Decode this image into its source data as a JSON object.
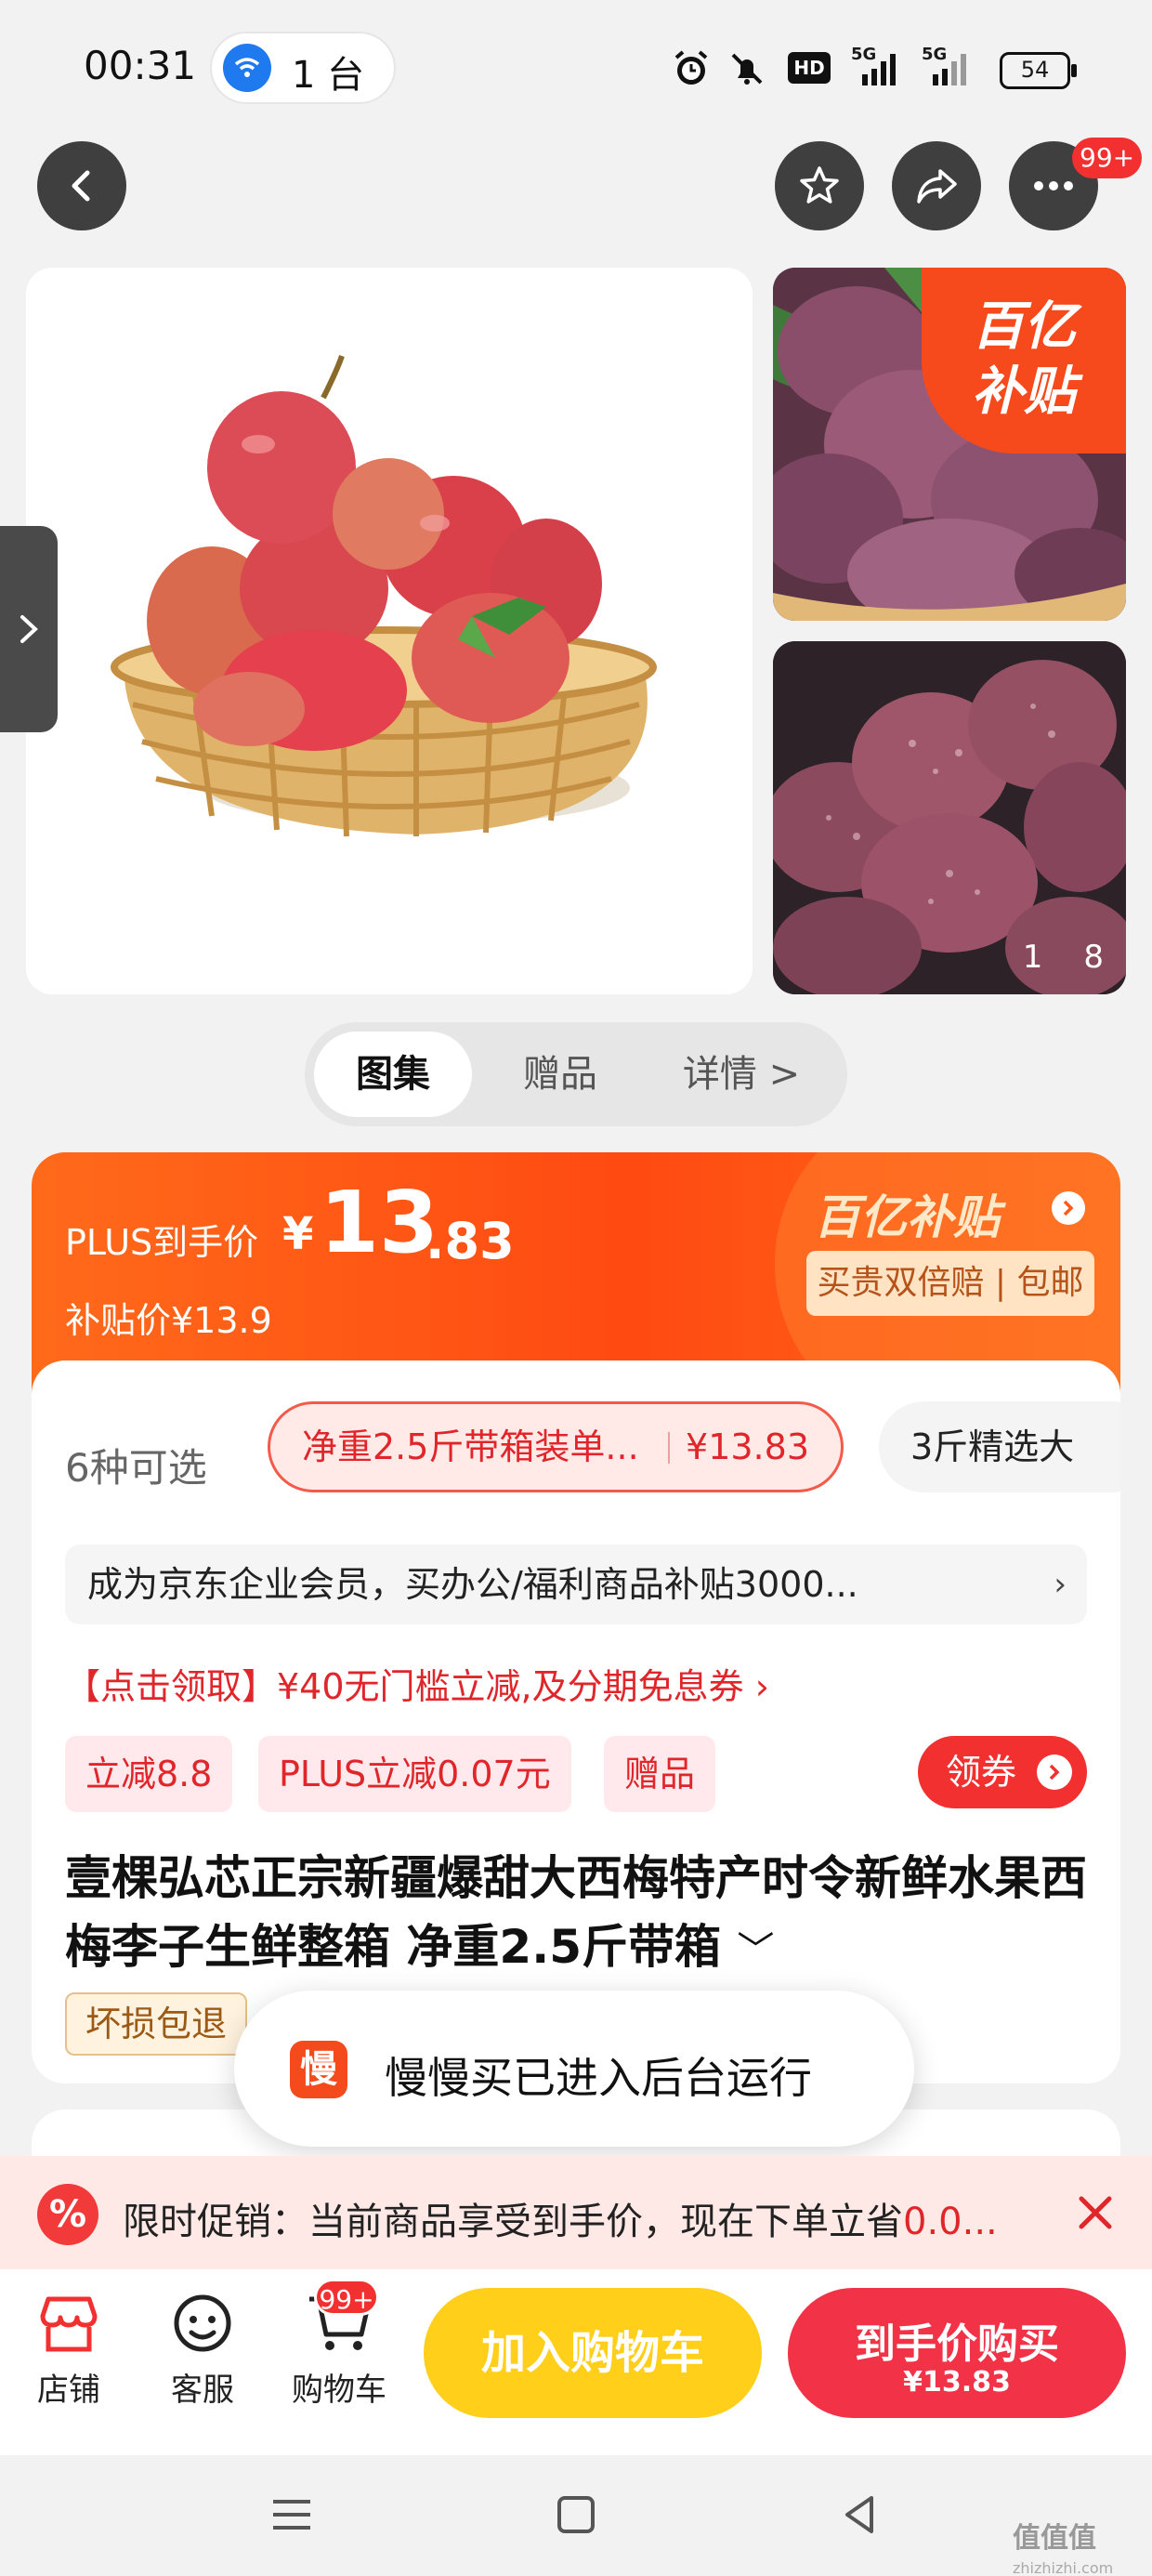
{
  "status_bar": {
    "time": "00:31",
    "hotspot_count": "1 台",
    "network_labels": [
      "HD",
      "5G",
      "5G"
    ],
    "battery": "54"
  },
  "nav": {
    "more_badge": "99+"
  },
  "gallery": {
    "pager_current": "1",
    "pager_total": "8",
    "promo_corner_line1": "百亿",
    "promo_corner_line2": "补贴"
  },
  "tabs": [
    {
      "label": "图集",
      "active": true
    },
    {
      "label": "赠品",
      "active": false
    },
    {
      "label": "详情 >",
      "active": false
    }
  ],
  "price": {
    "plus_label": "PLUS到手价",
    "currency": "¥",
    "integer": "13",
    "decimal": ".83",
    "subsidy_price": "补贴价¥13.9",
    "brand": "百亿补贴",
    "guarantee": "买贵双倍赔 | 包邮"
  },
  "options": {
    "count_label": "6种可选",
    "selected_name": "净重2.5斤带箱装单...",
    "selected_price": "¥13.83",
    "other_name": "3斤精选大"
  },
  "member_row": "成为京东企业会员，买办公/福利商品补贴3000...",
  "coupon_line": "【点击领取】¥40无门槛立减,及分期免息券 ›",
  "tags": [
    "立减8.8",
    "PLUS立减0.07元",
    "赠品"
  ],
  "coupon_button": "领券",
  "product_title": "壹棵弘芯正宗新疆爆甜大西梅特产时令新鲜水果西梅李子生鲜整箱 净重2.5斤带箱",
  "damage_tag": "坏损包退",
  "toast": {
    "icon_text": "慢",
    "message": "慢慢买已进入后台运行"
  },
  "promo_bar": {
    "prefix": "限时促销：当前商品享受到手价，现在下单立省",
    "amount": "0.0..."
  },
  "action_bar": {
    "shop": "店铺",
    "service": "客服",
    "cart": "购物车",
    "cart_badge": "99+",
    "add_to_cart": "加入购物车",
    "buy_line1": "到手价购买",
    "buy_line2": "¥13.83"
  },
  "watermark": {
    "main": "值值值",
    "sub": "zhizhizhi.com"
  },
  "colors": {
    "accent_red": "#f23030",
    "banner_orange": "#ff4a12",
    "cart_yellow": "#ffcf1a"
  }
}
